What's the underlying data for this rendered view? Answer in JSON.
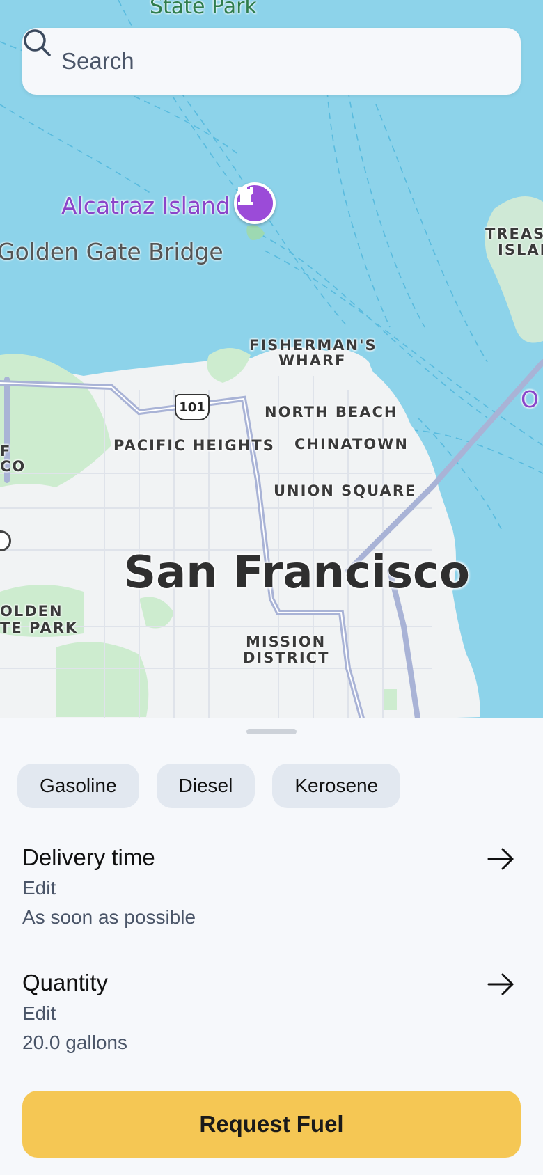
{
  "search": {
    "placeholder": "Search"
  },
  "map": {
    "labels": {
      "state_park": "State Park",
      "alcatraz": "Alcatraz Island",
      "golden_gate_bridge": "Golden Gate Bridge",
      "fishermans_wharf_1": "FISHERMAN'S",
      "fishermans_wharf_2": "WHARF",
      "north_beach": "NORTH BEACH",
      "pacific_heights": "PACIFIC HEIGHTS",
      "chinatown": "CHINATOWN",
      "union_square": "UNION SQUARE",
      "city": "San Francisco",
      "golden_gate_park_1": "OLDEN",
      "golden_gate_park_2": "TE PARK",
      "mission_1": "MISSION",
      "mission_2": "DISTRICT",
      "treasure_1": "TREAS",
      "treasure_2": "ISLAN",
      "left_edge_1": "F",
      "left_edge_2": "CO",
      "right_edge": "O",
      "highway": "101"
    },
    "colors": {
      "water": "#8dd3ea",
      "land": "#f1f3f4",
      "park": "#cdeccf",
      "road": "#a9b3d6"
    }
  },
  "fuel_types": [
    "Gasoline",
    "Diesel",
    "Kerosene"
  ],
  "delivery": {
    "title": "Delivery time",
    "edit": "Edit",
    "value": "As soon as possible"
  },
  "quantity": {
    "title": "Quantity",
    "edit": "Edit",
    "value": "20.0 gallons"
  },
  "cta": {
    "label": "Request Fuel",
    "color": "#f5c754"
  },
  "icons": {
    "search": "search-icon",
    "arrow": "arrow-right-icon",
    "landmark": "castle-icon"
  }
}
